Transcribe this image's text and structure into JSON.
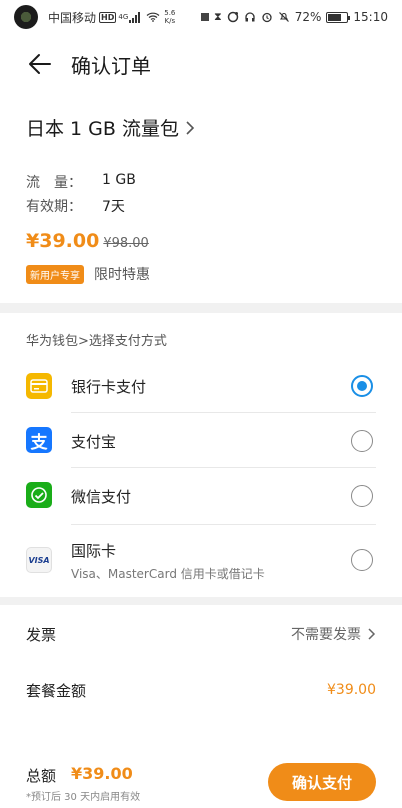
{
  "status_bar": {
    "carrier": "中国移动",
    "hd": "HD",
    "network": "4G",
    "speed_value": "5.6",
    "speed_unit": "K/s",
    "battery": "72%",
    "battery_level": 0.72,
    "time": "15:10"
  },
  "header": {
    "title": "确认订单",
    "back_icon": "arrow-left-icon"
  },
  "product": {
    "name": "日本 1 GB 流量包",
    "details": [
      {
        "label": "流　量：",
        "value": "1 GB"
      },
      {
        "label": "有效期：",
        "value": "7天"
      }
    ],
    "price": "¥39.00",
    "original_price": "¥98.00",
    "promo_badge": "新用户专享",
    "promo_text": "限时特惠"
  },
  "payment": {
    "header": "华为钱包>选择支付方式",
    "options": [
      {
        "label": "银行卡支付",
        "icon": "bank-card-icon",
        "selected": true
      },
      {
        "label": "支付宝",
        "icon": "alipay-icon",
        "selected": false
      },
      {
        "label": "微信支付",
        "icon": "wechat-pay-icon",
        "selected": false
      },
      {
        "label": "国际卡",
        "sublabel": "Visa、MasterCard 信用卡或借记卡",
        "icon": "visa-icon",
        "visa_text": "VISA",
        "selected": false
      }
    ]
  },
  "invoice": {
    "label": "发票",
    "value": "不需要发票"
  },
  "package_amount": {
    "label": "套餐金额",
    "value": "¥39.00"
  },
  "footer": {
    "total_label": "总额",
    "total_amount": "¥39.00",
    "note": "*预订后 30 天内启用有效",
    "confirm_label": "确认支付"
  },
  "colors": {
    "accent": "#f08c18",
    "radio_selected": "#1a8fe6",
    "card_yellow": "#f5b800",
    "alipay_blue": "#1677ff",
    "wechat_green": "#1aad19"
  }
}
